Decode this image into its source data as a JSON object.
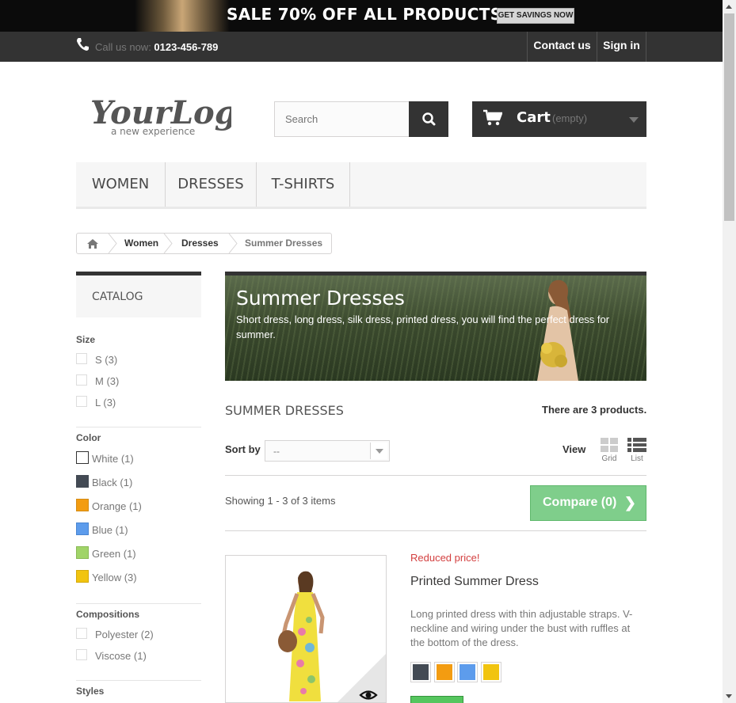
{
  "banner": {
    "text": "SALE 70% OFF ALL PRODUCTS",
    "button": "GET SAVINGS NOW"
  },
  "navbar": {
    "call_label": "Call us now: ",
    "phone": "0123-456-789",
    "contact": "Contact us",
    "signin": "Sign in"
  },
  "header": {
    "logo_text": "YourLogo",
    "logo_tagline": "a new experience",
    "search_placeholder": "Search",
    "cart_label": "Cart",
    "cart_status": "(empty)"
  },
  "menu": {
    "items": [
      "WOMEN",
      "DRESSES",
      "T-SHIRTS"
    ]
  },
  "breadcrumb": {
    "items": [
      "Women",
      "Dresses",
      "Summer Dresses"
    ]
  },
  "sidebar": {
    "catalog": "CATALOG",
    "size": {
      "title": "Size",
      "options": [
        "S (3)",
        "M (3)",
        "L (3)"
      ]
    },
    "color": {
      "title": "Color",
      "options": [
        {
          "label": "White (1)",
          "color": "#ffffff"
        },
        {
          "label": "Black (1)",
          "color": "#434a54"
        },
        {
          "label": "Orange (1)",
          "color": "#f39c11"
        },
        {
          "label": "Blue (1)",
          "color": "#5d9cec"
        },
        {
          "label": "Green (1)",
          "color": "#a0d468"
        },
        {
          "label": "Yellow (3)",
          "color": "#f1c40f"
        }
      ]
    },
    "compositions": {
      "title": "Compositions",
      "options": [
        "Polyester (2)",
        "Viscose (1)"
      ]
    },
    "styles": {
      "title": "Styles"
    }
  },
  "category": {
    "title": "Summer Dresses",
    "description": "Short dress, long dress, silk dress, printed dress, you will find the perfect dress for summer.",
    "heading": "SUMMER DRESSES",
    "count": "There are 3 products."
  },
  "toolbar": {
    "sort_label": "Sort by",
    "sort_value": "--",
    "view_label": "View",
    "grid_label": "Grid",
    "list_label": "List",
    "showing": "Showing 1 - 3 of 3 items",
    "compare": "Compare (0)"
  },
  "product": {
    "badge": "Reduced price!",
    "name": "Printed Summer Dress",
    "description": "Long printed dress with thin adjustable straps. V-neckline and wiring under the bust with ruffles at the bottom of the dress.",
    "colors": [
      "#434a54",
      "#f39c11",
      "#5d9cec",
      "#f1c40f"
    ]
  }
}
